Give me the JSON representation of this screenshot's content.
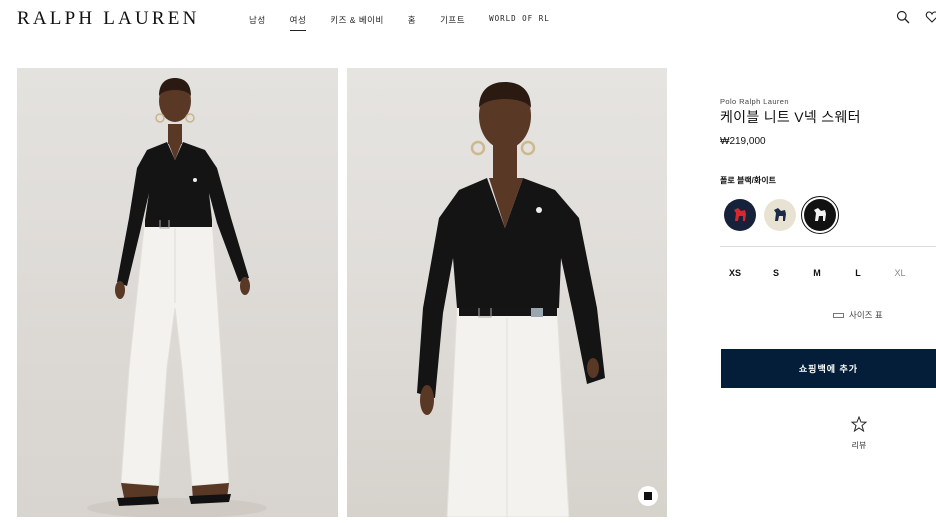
{
  "header": {
    "logo": "RALPH LAUREN",
    "nav": [
      {
        "label": "남성",
        "active": false
      },
      {
        "label": "여성",
        "active": true
      },
      {
        "label": "키즈 & 베이비",
        "active": false
      },
      {
        "label": "홈",
        "active": false
      },
      {
        "label": "기프트",
        "active": false
      },
      {
        "label": "WORLD OF RL",
        "active": false
      }
    ],
    "icons": [
      "search-icon",
      "heart-icon"
    ]
  },
  "gallery": {
    "images": [
      "model-full-body-photo",
      "model-closeup-photo"
    ],
    "video_icon": "video-play-icon"
  },
  "product": {
    "brand": "Polo Ralph Lauren",
    "title": "케이블 니트 V넥 스웨터",
    "price": "₩219,000",
    "color_label": "폴로 블랙/화이트",
    "swatches": [
      {
        "name": "navy-red-pony",
        "bg": "#16213a",
        "pony": "#d8282f",
        "selected": false
      },
      {
        "name": "cream-navy-pony",
        "bg": "#e8e2d2",
        "pony": "#1c2a4a",
        "selected": false
      },
      {
        "name": "black-white-pony",
        "bg": "#111111",
        "pony": "#f2f2f2",
        "selected": true
      }
    ],
    "sizes": [
      {
        "label": "XS",
        "available": true
      },
      {
        "label": "S",
        "available": true
      },
      {
        "label": "M",
        "available": true
      },
      {
        "label": "L",
        "available": true
      },
      {
        "label": "XL",
        "available": false
      }
    ],
    "size_chart_label": "사이즈 표",
    "add_to_bag_label": "쇼핑백에 추가",
    "review_label": "리뷰",
    "accent_color": "#041e3a"
  }
}
